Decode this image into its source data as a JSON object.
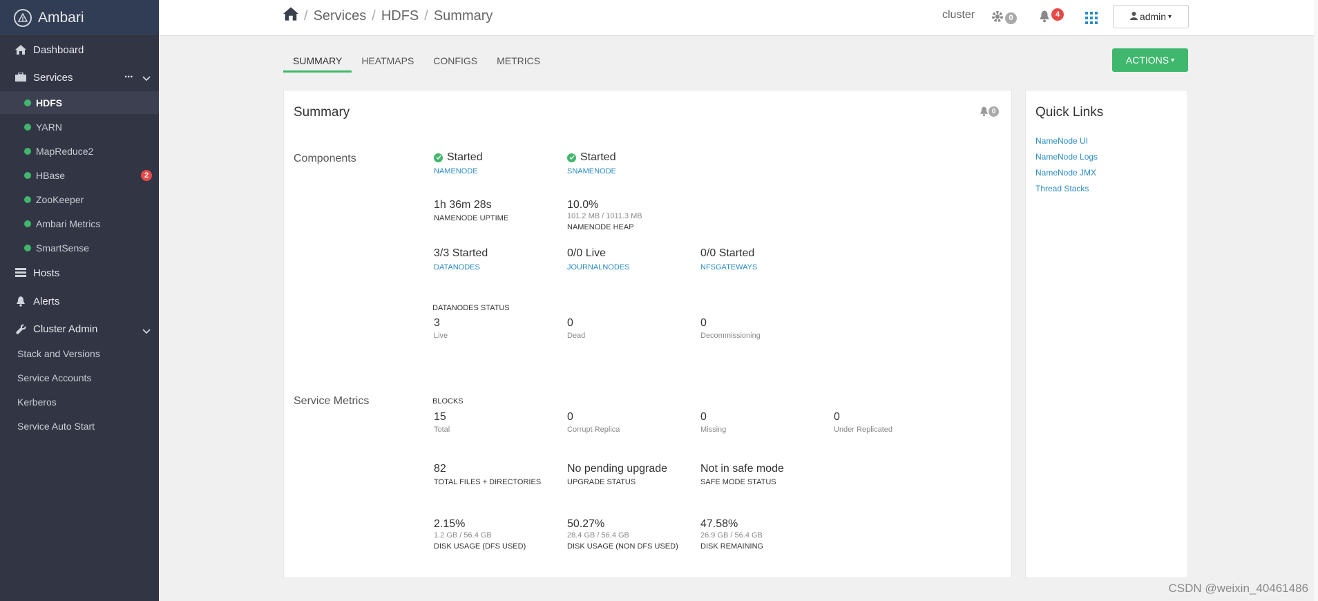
{
  "brand": {
    "name": "Ambari"
  },
  "nav": {
    "dashboard": "Dashboard",
    "services": "Services",
    "services_more": "...",
    "hosts": "Hosts",
    "alerts": "Alerts",
    "cluster_admin": "Cluster Admin"
  },
  "services": [
    {
      "label": "HDFS",
      "active": true
    },
    {
      "label": "YARN"
    },
    {
      "label": "MapReduce2"
    },
    {
      "label": "HBase",
      "badge": "2"
    },
    {
      "label": "ZooKeeper"
    },
    {
      "label": "Ambari Metrics"
    },
    {
      "label": "SmartSense"
    }
  ],
  "cluster_admin_items": [
    "Stack and Versions",
    "Service Accounts",
    "Kerberos",
    "Service Auto Start"
  ],
  "breadcrumb": {
    "sep": "/",
    "services": "Services",
    "service": "HDFS",
    "page": "Summary"
  },
  "topbar": {
    "cluster": "cluster",
    "ops_count": "0",
    "alerts_count": "4",
    "user": "admin",
    "caret": "▾"
  },
  "tabs": [
    "SUMMARY",
    "HEATMAPS",
    "CONFIGS",
    "METRICS"
  ],
  "actions_label": "ACTIONS",
  "summary": {
    "title": "Summary",
    "alert_count": "0",
    "components_label": "Components",
    "service_metrics_label": "Service Metrics",
    "namenode": {
      "status": "Started",
      "label": "NAMENODE"
    },
    "snamenode": {
      "status": "Started",
      "label": "SNAMENODE"
    },
    "uptime": {
      "value": "1h 36m 28s",
      "label": "NAMENODE UPTIME"
    },
    "heap": {
      "value": "10.0%",
      "sub": "101.2 MB / 1011.3 MB",
      "label": "NAMENODE HEAP"
    },
    "datanodes": {
      "value": "3/3 Started",
      "label": "DATANODES"
    },
    "journalnodes": {
      "value": "0/0 Live",
      "label": "JOURNALNODES"
    },
    "nfsgateways": {
      "value": "0/0 Started",
      "label": "NFSGATEWAYS"
    },
    "datanodes_status": {
      "title": "DATANODES STATUS",
      "live": {
        "value": "3",
        "label": "Live"
      },
      "dead": {
        "value": "0",
        "label": "Dead"
      },
      "decom": {
        "value": "0",
        "label": "Decommissioning"
      }
    },
    "blocks": {
      "title": "BLOCKS",
      "total": {
        "value": "15",
        "label": "Total"
      },
      "corrupt": {
        "value": "0",
        "label": "Corrupt Replica"
      },
      "missing": {
        "value": "0",
        "label": "Missing"
      },
      "under": {
        "value": "0",
        "label": "Under Replicated"
      }
    },
    "files": {
      "value": "82",
      "label": "TOTAL FILES + DIRECTORIES"
    },
    "upgrade": {
      "value": "No pending upgrade",
      "label": "UPGRADE STATUS"
    },
    "safemode": {
      "value": "Not in safe mode",
      "label": "SAFE MODE STATUS"
    },
    "disk_dfs": {
      "value": "2.15%",
      "sub": "1.2 GB / 56.4 GB",
      "label": "DISK USAGE (DFS USED)"
    },
    "disk_non_dfs": {
      "value": "50.27%",
      "sub": "28.4 GB / 56.4 GB",
      "label": "DISK USAGE (NON DFS USED)"
    },
    "disk_remaining": {
      "value": "47.58%",
      "sub": "26.9 GB / 56.4 GB",
      "label": "DISK REMAINING"
    }
  },
  "quick_links": {
    "title": "Quick Links",
    "links": [
      "NameNode UI",
      "NameNode Logs",
      "NameNode JMX",
      "Thread Stacks"
    ]
  },
  "watermark": "CSDN @weixin_40461486",
  "colors": {
    "sidebar": "#323544",
    "accent_green": "#3fb76d",
    "link_blue": "#2a8bc7",
    "badge_red": "#e64a48"
  }
}
